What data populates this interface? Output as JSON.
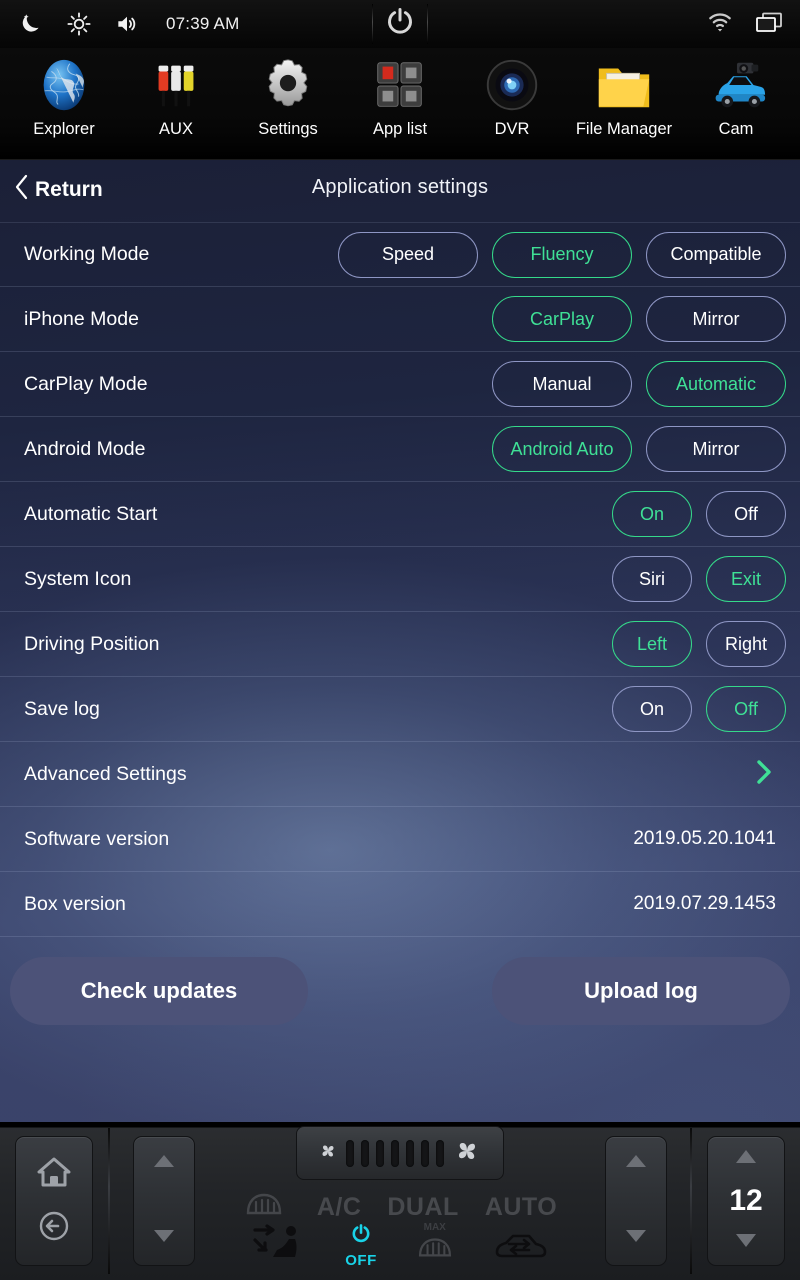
{
  "statusbar": {
    "time": "07:39 AM",
    "icons": {
      "night": "moon-star-icon",
      "brightness": "brightness-icon",
      "volume": "volume-icon",
      "power": "power-icon",
      "wifi": "wifi-icon",
      "recents": "recent-apps-icon"
    }
  },
  "dock": {
    "apps": [
      {
        "label": "Explorer",
        "icon": "globe-icon"
      },
      {
        "label": "AUX",
        "icon": "rca-cable-icon"
      },
      {
        "label": "Settings",
        "icon": "gear-icon"
      },
      {
        "label": "App list",
        "icon": "app-grid-icon"
      },
      {
        "label": "DVR",
        "icon": "camera-lens-icon"
      },
      {
        "label": "File Manager",
        "icon": "folder-icon"
      },
      {
        "label": "Cam",
        "icon": "car-camera-icon"
      }
    ]
  },
  "header": {
    "return_label": "Return",
    "title": "Application settings"
  },
  "colors": {
    "selected": "#3fe096",
    "unselected_border": "#8e96c4",
    "action_button": "#4c5278",
    "accent_off": "#19d3e8"
  },
  "settings": {
    "rows": [
      {
        "label": "Working Mode",
        "type": "options",
        "size": "wide",
        "options": [
          {
            "label": "Speed",
            "selected": false
          },
          {
            "label": "Fluency",
            "selected": true
          },
          {
            "label": "Compatible",
            "selected": false
          }
        ]
      },
      {
        "label": "iPhone Mode",
        "type": "options",
        "size": "med",
        "options": [
          {
            "label": "CarPlay",
            "selected": true
          },
          {
            "label": "Mirror",
            "selected": false
          }
        ]
      },
      {
        "label": "CarPlay Mode",
        "type": "options",
        "size": "med",
        "options": [
          {
            "label": "Manual",
            "selected": false
          },
          {
            "label": "Automatic",
            "selected": true
          }
        ]
      },
      {
        "label": "Android Mode",
        "type": "options",
        "size": "med",
        "options": [
          {
            "label": "Android Auto",
            "selected": true
          },
          {
            "label": "Mirror",
            "selected": false
          }
        ]
      },
      {
        "label": "Automatic Start",
        "type": "options",
        "size": "small",
        "options": [
          {
            "label": "On",
            "selected": true
          },
          {
            "label": "Off",
            "selected": false
          }
        ]
      },
      {
        "label": "System Icon",
        "type": "options",
        "size": "small",
        "options": [
          {
            "label": "Siri",
            "selected": false
          },
          {
            "label": "Exit",
            "selected": true
          }
        ]
      },
      {
        "label": "Driving Position",
        "type": "options",
        "size": "small",
        "options": [
          {
            "label": "Left",
            "selected": true
          },
          {
            "label": "Right",
            "selected": false
          }
        ]
      },
      {
        "label": "Save log",
        "type": "options",
        "size": "small",
        "options": [
          {
            "label": "On",
            "selected": false
          },
          {
            "label": "Off",
            "selected": true
          }
        ]
      },
      {
        "label": "Advanced Settings",
        "type": "nav"
      },
      {
        "label": "Software version",
        "type": "value",
        "value": "2019.05.20.1041"
      },
      {
        "label": "Box version",
        "type": "value",
        "value": "2019.07.29.1453"
      }
    ],
    "actions": {
      "check_updates": "Check updates",
      "upload_log": "Upload log"
    }
  },
  "climate": {
    "home_icon": "home-icon",
    "back_icon": "back-arrow-icon",
    "fan_bars": 7,
    "labels": [
      "A/C",
      "DUAL",
      "AUTO"
    ],
    "power_state": "OFF",
    "max_label": "MAX",
    "temperature": "12",
    "icons": {
      "front_defrost": "front-defrost-icon",
      "airflow_seat": "airflow-seat-icon",
      "power": "power-icon",
      "rear_defrost": "rear-defrost-icon",
      "recirculation": "air-recirculation-icon",
      "up": "arrow-up-icon",
      "down": "arrow-down-icon"
    }
  }
}
